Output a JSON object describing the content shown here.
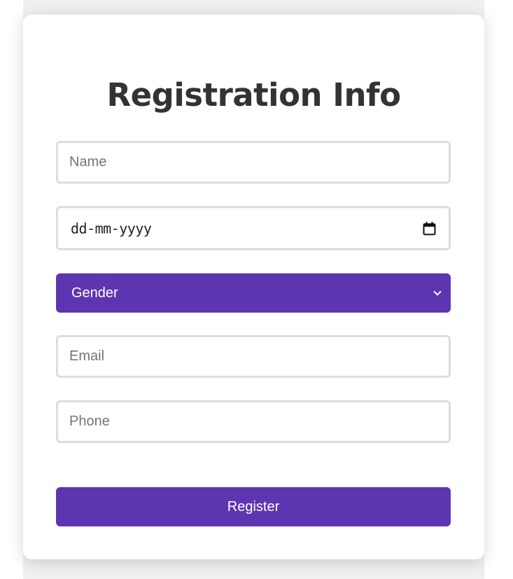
{
  "form": {
    "title": "Registration Info",
    "name_placeholder": "Name",
    "date_placeholder": "dd-mm-yyyy",
    "gender_selected": "Gender",
    "email_placeholder": "Email",
    "phone_placeholder": "Phone",
    "register_label": "Register"
  },
  "icons": {
    "date_picker": "calendar-icon",
    "select_arrow": "chevron-down-icon"
  },
  "colors": {
    "accent": "#5e35b1",
    "title_text": "#333333",
    "input_border": "#dddddd",
    "page_background": "#f0f0f0"
  }
}
